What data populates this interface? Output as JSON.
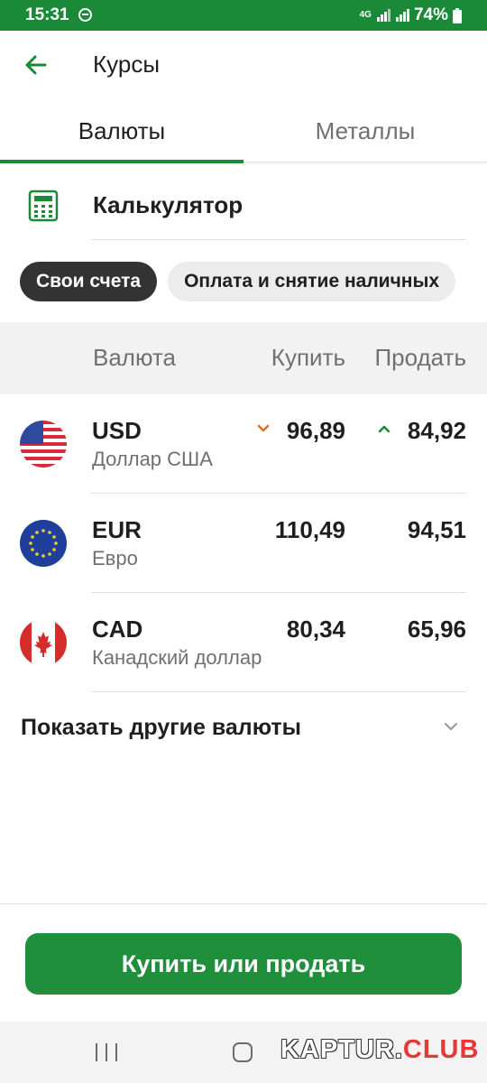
{
  "status_bar": {
    "time": "15:31",
    "network": "4G",
    "battery": "74%"
  },
  "app_bar": {
    "title": "Курсы",
    "back_icon": "arrow-left-icon"
  },
  "tabs": [
    {
      "label": "Валюты",
      "active": true
    },
    {
      "label": "Металлы",
      "active": false
    }
  ],
  "calculator": {
    "label": "Калькулятор",
    "icon": "calculator-icon"
  },
  "chips": [
    {
      "label": "Свои счета",
      "selected": true
    },
    {
      "label": "Оплата и снятие наличных",
      "selected": false
    }
  ],
  "table": {
    "headers": {
      "currency": "Валюта",
      "buy": "Купить",
      "sell": "Продать"
    },
    "rows": [
      {
        "code": "USD",
        "name": "Доллар США",
        "buy": "96,89",
        "sell": "84,92",
        "buy_trend": "down",
        "sell_trend": "up",
        "flag": "us-flag-icon"
      },
      {
        "code": "EUR",
        "name": "Евро",
        "buy": "110,49",
        "sell": "94,51",
        "flag": "eu-flag-icon"
      },
      {
        "code": "CAD",
        "name": "Канадский доллар",
        "buy": "80,34",
        "sell": "65,96",
        "flag": "ca-flag-icon"
      }
    ]
  },
  "show_more": {
    "label": "Показать другие валюты",
    "icon": "chevron-down-icon"
  },
  "cta": {
    "label": "Купить или продать"
  },
  "watermark": {
    "part1": "KAPTUR.",
    "part2": "CLUB"
  },
  "colors": {
    "brand_green": "#1a8a39",
    "trend_down": "#e07020",
    "trend_up": "#1a8a39"
  }
}
